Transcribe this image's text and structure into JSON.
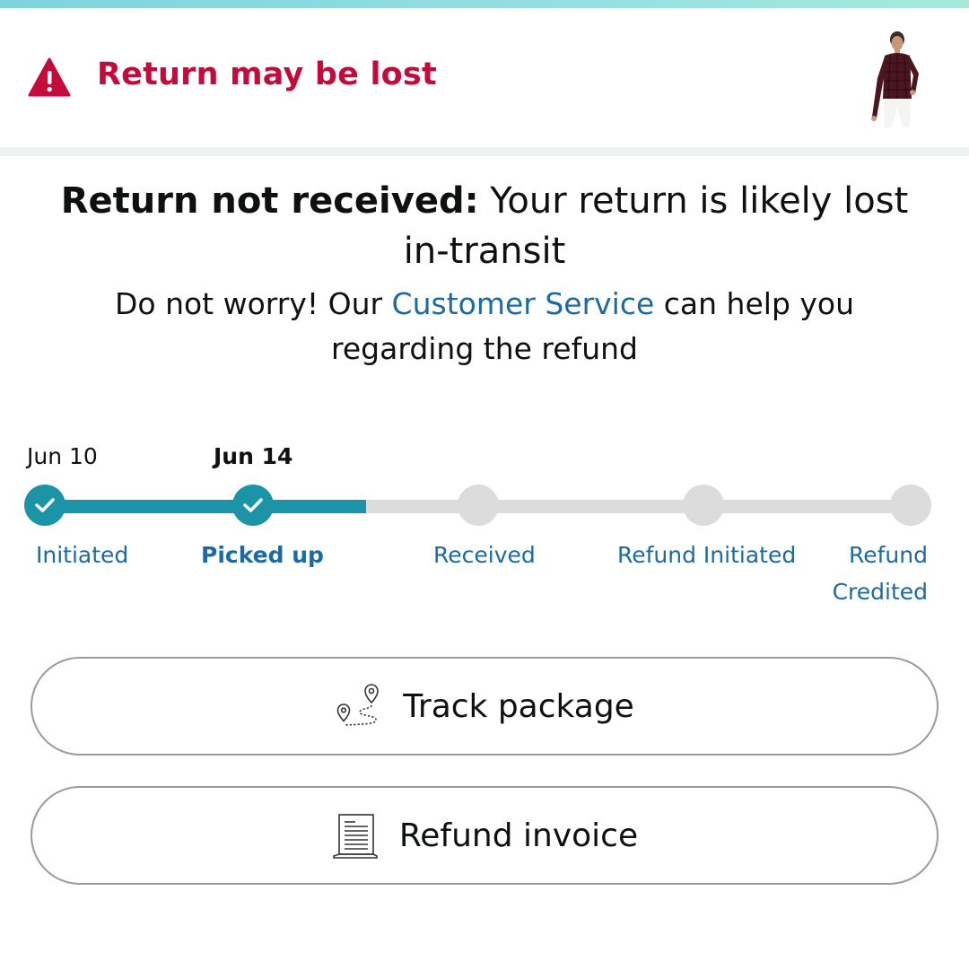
{
  "alert": {
    "title": "Return may be lost",
    "icon": "warning-triangle-icon",
    "color": "#c40c3c"
  },
  "product": {
    "image": "product-thumbnail-shirt"
  },
  "message": {
    "headline_bold": "Return not received:",
    "headline_rest": " Your return is likely lost in-transit",
    "body_prefix": "Do not worry! Our ",
    "body_link": "Customer Service",
    "body_suffix": " can help you regarding the refund"
  },
  "timeline": {
    "dates": [
      "Jun 10",
      "Jun 14"
    ],
    "steps": [
      {
        "label": "Initiated",
        "status": "done"
      },
      {
        "label": "Picked up",
        "status": "current"
      },
      {
        "label": "Received",
        "status": "pending"
      },
      {
        "label": "Refund Initiated",
        "status": "pending"
      },
      {
        "label": "Refund Credited",
        "status": "pending"
      }
    ],
    "accent_color": "#1b94a8"
  },
  "actions": {
    "track_package": "Track package",
    "refund_invoice": "Refund invoice"
  }
}
